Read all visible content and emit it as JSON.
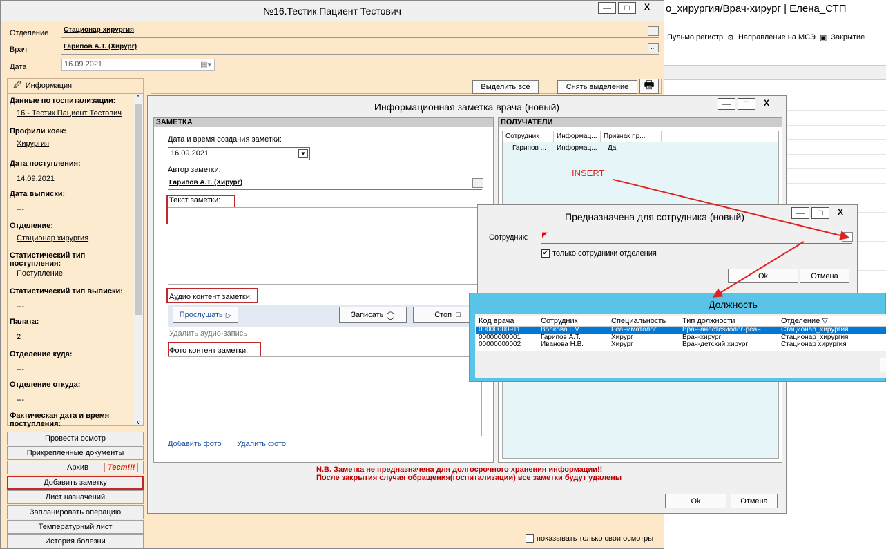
{
  "bg_window": {
    "title": "о_хирургия/Врач-хирург | Елена_СТП",
    "toolbar": [
      "Пульмо регистр",
      "Направление на МСЭ",
      "Закрытие"
    ]
  },
  "patient_window": {
    "title": "№16.Тестик Пациент Тестович",
    "controls": [
      "—",
      "□",
      "X"
    ],
    "fields": [
      {
        "label": "Отделение",
        "value": "Стационар хирургия"
      },
      {
        "label": "Врач",
        "value": "Гарипов А.Т. (Хирург)"
      },
      {
        "label": "Дата",
        "value": "16.09.2021"
      }
    ],
    "info_tab": "Информация",
    "select_all": "Выделить все",
    "deselect": "Снять выделение",
    "info_sections": [
      {
        "h": "Данные по госпитализации:",
        "v": "16 - Тестик Пациент Тестович",
        "link": true
      },
      {
        "h": "Профили коек:",
        "v": "Хирургия",
        "link": true
      },
      {
        "h": "Дата поступления:",
        "v": "14.09.2021",
        "link": false
      },
      {
        "h": "Дата выписки:",
        "v": "---",
        "link": false
      },
      {
        "h": "Отделение:",
        "v": "Стационар хирургия",
        "link": true
      },
      {
        "h": "Статистический тип поступления:",
        "v": "Поступление",
        "link": false
      },
      {
        "h": "Статистический тип выписки:",
        "v": "---",
        "link": false
      },
      {
        "h": "Палата:",
        "v": "2",
        "link": false
      },
      {
        "h": "Отделение куда:",
        "v": "---",
        "link": false
      },
      {
        "h": "Отделение откуда:",
        "v": "---",
        "link": false
      },
      {
        "h": "Фактическая дата и время поступления:",
        "v": "",
        "link": false
      }
    ],
    "nav_buttons": [
      "Провести осмотр",
      "Прикрепленные документы",
      "Архив",
      "Добавить заметку",
      "Лист назначений",
      "Запланировать операцию",
      "Температурный лист",
      "История болезни"
    ],
    "test_badge": "Тест!!!",
    "own_checkbox": "показывать только свои осмотры"
  },
  "note_dialog": {
    "title": "Информационная заметка врача (новый)",
    "note_header": "ЗАМЕТКА",
    "recipients_header": "ПОЛУЧАТЕЛИ",
    "date_label": "Дата и время создания заметки:",
    "date_value": "16.09.2021",
    "author_label": "Автор заметки:",
    "author_value": "Гарипов А.Т. (Хирург)",
    "text_label": "Текст заметки:",
    "audio_label": "Аудио контент заметки:",
    "listen": "Прослушать",
    "record": "Записать",
    "stop": "Стоп",
    "delete_audio": "Удалить аудио-запись",
    "photo_label": "Фото контент заметки:",
    "add_photo": "Добавить фото",
    "delete_photo": "Удалить фото",
    "recipients_cols": [
      "Сотрудник",
      "Информац...",
      "Признак пр..."
    ],
    "recipients_rows": [
      [
        "Гарипов ...",
        "Информац...",
        "Да"
      ]
    ],
    "warning1": "N.B. Заметка не предназначена для долгосрочного хранения информации!!",
    "warning2": "После закрытия случая обращения(госпитализации) все заметки будут удалены",
    "ok": "Ok",
    "cancel": "Отмена"
  },
  "annotation": {
    "insert": "INSERT",
    "color": "#e0231f"
  },
  "employee_dialog": {
    "title": "Предназначена для сотрудника (новый)",
    "employee_label": "Сотрудник:",
    "only_dept": "только сотрудники отделения",
    "ok": "Ok",
    "cancel": "Отмена"
  },
  "position_dialog": {
    "title": "Должность",
    "columns": [
      "Код врача",
      "Сотрудник",
      "Специальность",
      "Тип должности",
      "Отделение"
    ],
    "rows": [
      [
        "00000000911",
        "Волкова Г.М.",
        "Реаниматолог",
        "Врач-анестезиолог-реан...",
        "Стационар_хирургия"
      ],
      [
        "00000000001",
        "Гарипов А.Т.",
        "Хирург",
        "Врач-хирург",
        "Стационар_хирургия"
      ],
      [
        "00000000002",
        "Иванова Н.В.",
        "Хирург",
        "Врач-детский хирург",
        "Стационар хирургия"
      ]
    ]
  }
}
